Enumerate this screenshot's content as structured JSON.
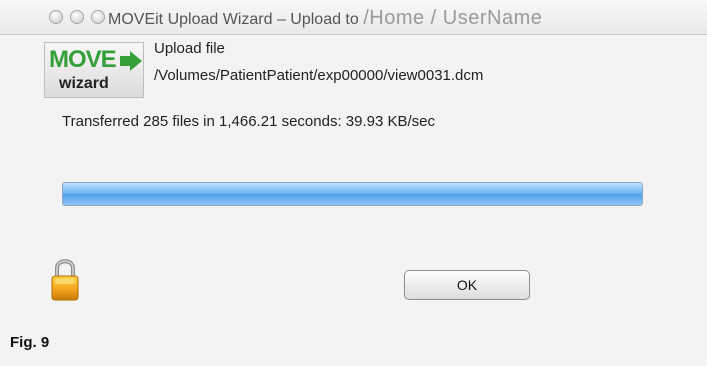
{
  "window": {
    "title_main": "MOVEit Upload Wizard – Upload to ",
    "title_path": "/Home / UserName"
  },
  "logo": {
    "move_text": "MOVE",
    "wizard_text": "wizard"
  },
  "upload": {
    "label": "Upload file",
    "file_path": "/Volumes/PatientPatient/exp00000/view0031.dcm"
  },
  "status": {
    "transfer_text": "Transferred 285 files in 1,466.21 seconds: 39.93 KB/sec",
    "progress_fraction": 1.0
  },
  "buttons": {
    "ok_label": "OK"
  },
  "caption": {
    "figure_label": "Fig. 9"
  },
  "icons": {
    "lock": "lock-icon",
    "arrow": "arrow-right-icon"
  },
  "colors": {
    "logo_green": "#35a03a",
    "progress_blue": "#6ab3f2"
  }
}
